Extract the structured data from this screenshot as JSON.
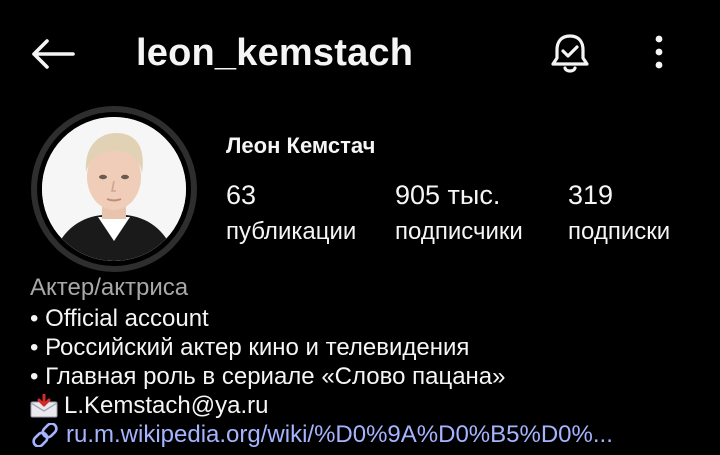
{
  "header": {
    "username": "leon_kemstach",
    "back_icon": "arrow-left-icon",
    "bell_icon": "bell-check-icon",
    "more_icon": "vertical-dots-icon"
  },
  "profile": {
    "full_name": "Леон Кемстач",
    "stats": [
      {
        "value": "63",
        "label": "публикации"
      },
      {
        "value": "905 тыс.",
        "label": "подписчики"
      },
      {
        "value": "319",
        "label": "подписки"
      }
    ],
    "category": "Актер/актриса",
    "bio_lines": [
      "• Official account",
      "• Российский актер кино и телевидения",
      "• Главная роль в сериале «Слово пацана»"
    ],
    "email": "L.Kemstach@ya.ru",
    "link": "ru.m.wikipedia.org/wiki/%D0%9A%D0%B5%D0%..."
  },
  "colors": {
    "background": "#000000",
    "text": "#f5f5f5",
    "muted": "#a8a8a8",
    "link": "#a5b4ff"
  }
}
